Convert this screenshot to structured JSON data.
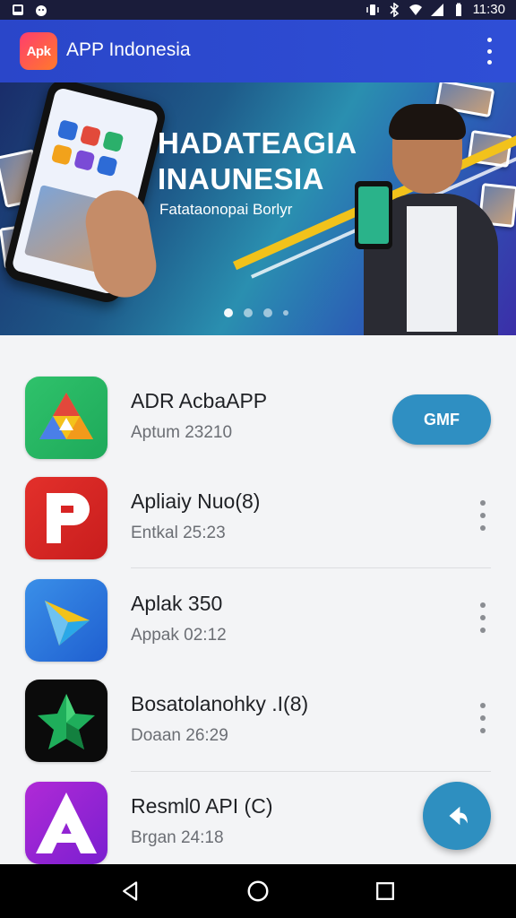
{
  "status_bar": {
    "time": "11:30"
  },
  "app_bar": {
    "logo_text": "Apk",
    "title": "APP Indonesia"
  },
  "banner": {
    "headline_line1": "HADATEAGIA",
    "headline_line2": "INAUNESIA",
    "subtitle": "Fatataonopai Borlyr",
    "carousel": {
      "pages": 4,
      "active_index": 1
    }
  },
  "apps": [
    {
      "title": "ADR AcbaAPP",
      "subtitle": "Aptum 23210",
      "action": "GMF",
      "icon": "drive-triangle-icon"
    },
    {
      "title": "Apliaiy Nuo(8)",
      "subtitle": "Entkal 25:23",
      "icon": "red-p-icon"
    },
    {
      "title": "Aplak 350",
      "subtitle": "Appak 02:12",
      "icon": "blue-play-icon"
    },
    {
      "title": "Bosatolanohky .I(8)",
      "subtitle": "Doaan 26:29",
      "icon": "green-star-icon"
    },
    {
      "title": "Resml0 API (C)",
      "subtitle": "Brgan 24:18",
      "icon": "purple-a-icon"
    }
  ],
  "colors": {
    "app_bar": "#2f4ed6",
    "accent": "#2f8fc2",
    "nav_bar": "#000000"
  }
}
